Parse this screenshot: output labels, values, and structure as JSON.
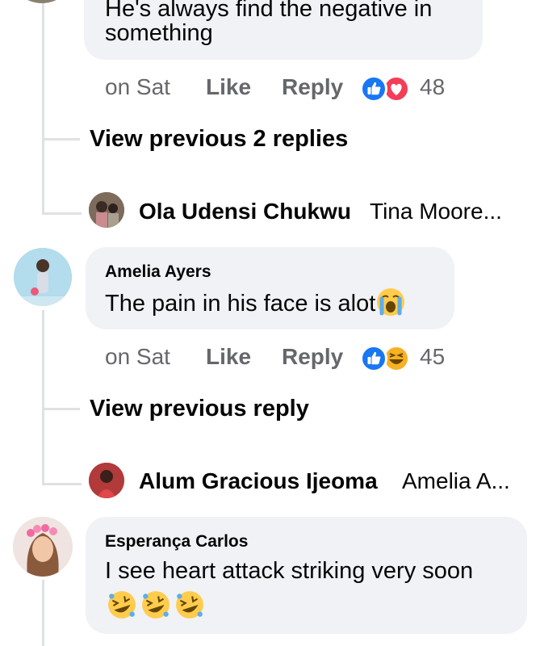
{
  "thread": [
    {
      "text_line1": "He's always find the negative in",
      "text_line2": "something",
      "time": "on Sat",
      "like": "Like",
      "reply": "Reply",
      "reactions": [
        "like-icon",
        "love-icon"
      ],
      "reaction_count": "48",
      "view_previous": "View previous 2 replies",
      "reply_preview": {
        "name": "Ola Udensi Chukwu",
        "text": "Tina Moore..."
      }
    },
    {
      "author": "Amelia Ayers",
      "text": "The pain in his face is alot",
      "text_emoji": "loudly-crying-face-emoji",
      "time": "on Sat",
      "like": "Like",
      "reply": "Reply",
      "reactions": [
        "like-icon",
        "haha-icon"
      ],
      "reaction_count": "45",
      "view_previous": "View previous reply",
      "reply_preview": {
        "name": "Alum Gracious Ijeoma",
        "text": "Amelia A..."
      }
    },
    {
      "author": "Esperança Carlos",
      "text": "I see heart attack striking very soon",
      "text_emojis": [
        "rolling-on-floor-laughing-emoji",
        "rolling-on-floor-laughing-emoji",
        "rolling-on-floor-laughing-emoji"
      ]
    }
  ],
  "colors": {
    "bubble": "#f0f2f5",
    "meta": "#65676b",
    "like_blue": "#1877f2",
    "love_red": "#f33e58",
    "haha_yellow": "#f7b125",
    "thread_line": "#dfe1e5"
  }
}
